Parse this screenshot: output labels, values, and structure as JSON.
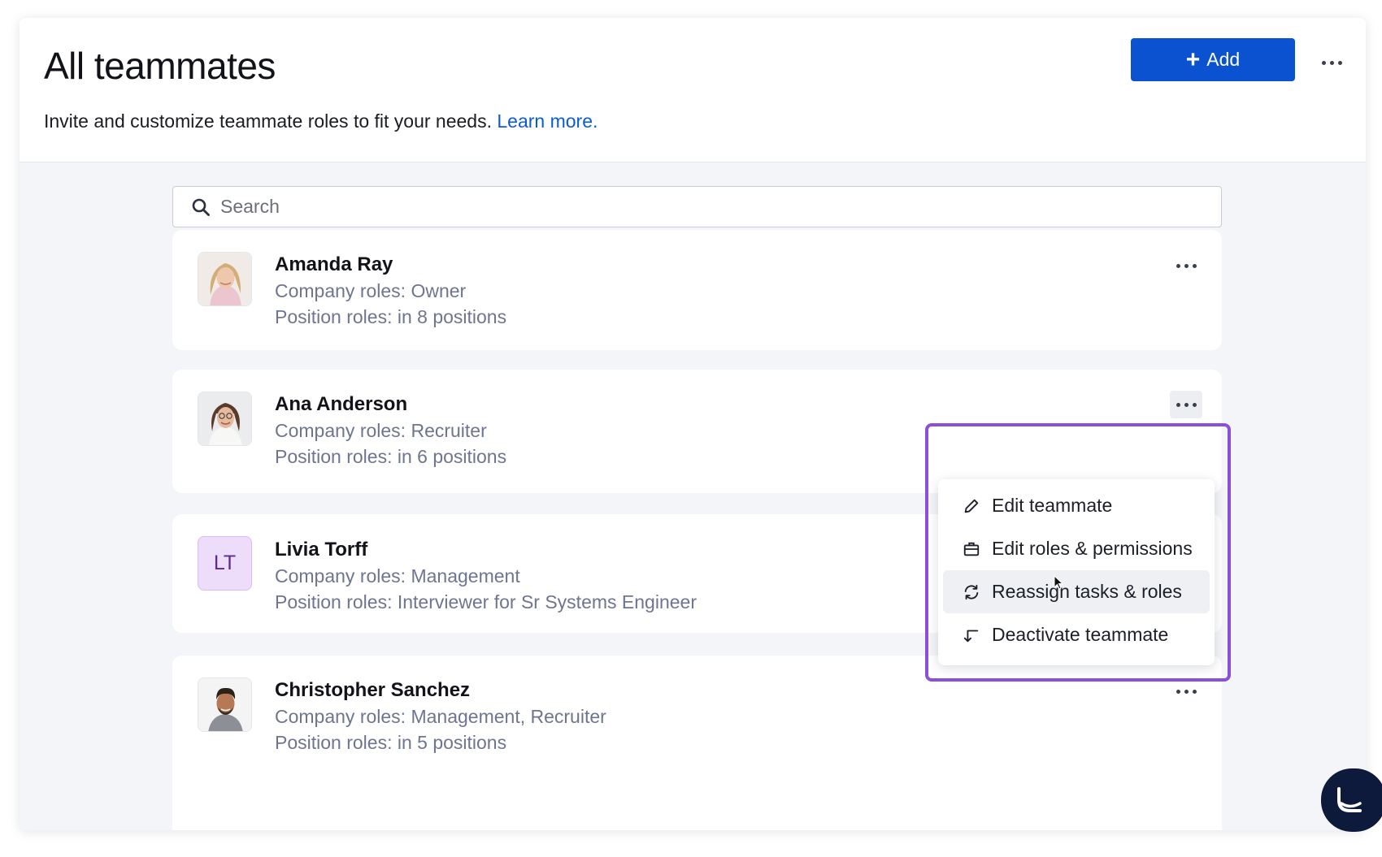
{
  "header": {
    "title": "All teammates",
    "subtitle": "Invite and customize teammate roles to fit your needs.",
    "learn_more": "Learn more.",
    "add_label": "Add",
    "add_icon": "plus-icon",
    "menu_icon": "more-dots-icon"
  },
  "search": {
    "placeholder": "Search",
    "value": "",
    "icon": "search-icon"
  },
  "teammates": [
    {
      "name": "Amanda Ray",
      "company_roles": "Company roles: Owner",
      "position_roles": "Position roles: in 8 positions",
      "avatar": "photo"
    },
    {
      "name": "Ana Anderson",
      "company_roles": "Company roles: Recruiter",
      "position_roles": "Position roles: in 6 positions",
      "avatar": "photo"
    },
    {
      "name": "Livia Torff",
      "initials": "LT",
      "company_roles": "Company roles: Management",
      "position_roles": "Position roles: Interviewer for Sr Systems Engineer",
      "avatar": "initials"
    },
    {
      "name": "Christopher Sanchez",
      "company_roles": "Company roles: Management, Recruiter",
      "position_roles": "Position roles: in 5 positions",
      "avatar": "photo"
    }
  ],
  "context_menu": {
    "items": [
      {
        "label": "Edit teammate",
        "icon": "pencil-icon"
      },
      {
        "label": "Edit roles & permissions",
        "icon": "briefcase-icon"
      },
      {
        "label": "Reassign tasks & roles",
        "icon": "refresh-icon",
        "hovered": true
      },
      {
        "label": "Deactivate teammate",
        "icon": "deactivate-arrow-icon"
      }
    ]
  },
  "colors": {
    "primary": "#0a52d0",
    "link": "#0a5bd7",
    "highlight": "#8a50d8",
    "role_text": "#6e7590",
    "initials_bg": "#eedcfb",
    "chat_bubble": "#0d1a3c"
  }
}
